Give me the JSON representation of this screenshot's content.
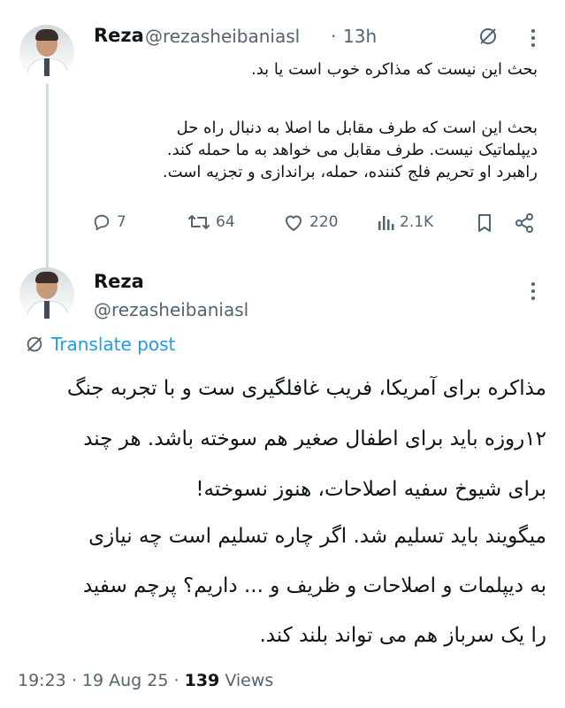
{
  "reply": {
    "author": {
      "name": "Reza",
      "handle": "@rezasheibaniasl",
      "separator": "·",
      "time": "13h"
    },
    "paragraphs": [
      [
        "بحث این نیست که مذاکره خوب است یا بد."
      ],
      [
        "بحث این است که طرف مقابل ما اصلا به دنبال راه حل",
        "دیپلماتیک نیست. طرف مقابل می خواهد به ما حمله کند.",
        "راهبرد او تحریم فلج کننده، حمله، براندازی و تجزیه است."
      ]
    ],
    "actions": {
      "replies": "7",
      "reposts": "64",
      "likes": "220",
      "views": "2.1K"
    }
  },
  "main": {
    "author": {
      "name": "Reza",
      "handle": "@rezasheibaniasl"
    },
    "translate_label": "Translate post",
    "lines": [
      "مذاکره برای آمریکا، فریب غافلگیری ست و با تجربه جنگ",
      "۱۲روزه باید برای اطفال صغیر هم سوخته باشد. هر چند",
      "برای شیوخ سفیه اصلاحات، هنوز نسوخته!",
      "میگویند باید تسلیم شد. اگر چاره تسلیم است چه نیازی",
      "به دیپلمات و اصلاحات و ظریف و ... داریم؟ پرچم سفید",
      "را یک سرباز هم می تواند بلند کند."
    ],
    "meta": {
      "time": "19:23",
      "date": "19 Aug 25",
      "dot": "·",
      "views_count": "139",
      "views_label": "Views"
    }
  },
  "icons": {
    "grok": "grok-icon",
    "more": "more-icon",
    "reply": "reply-icon",
    "repost": "repost-icon",
    "like": "like-icon",
    "views": "views-icon",
    "bookmark": "bookmark-icon",
    "share": "share-icon",
    "translate": "translate-icon"
  },
  "colors": {
    "text": "#0f1419",
    "muted": "#536471",
    "link": "#1d9bf0",
    "thread_line": "#cfd9de"
  }
}
